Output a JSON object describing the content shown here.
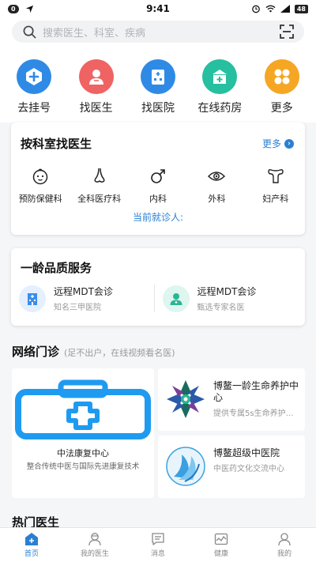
{
  "status_bar": {
    "left_badge": "0",
    "time": "9:41",
    "battery": "48"
  },
  "search": {
    "placeholder": "搜索医生、科室、疾病"
  },
  "quick_actions": [
    {
      "label": "去挂号",
      "icon": "add-circle-icon",
      "color": "#2f8ae6"
    },
    {
      "label": "找医生",
      "icon": "doctor-icon",
      "color": "#ef6363"
    },
    {
      "label": "找医院",
      "icon": "hospital-icon",
      "color": "#2f8ae6"
    },
    {
      "label": "在线药房",
      "icon": "pharmacy-icon",
      "color": "#26bfa0"
    },
    {
      "label": "更多",
      "icon": "more-apps-icon",
      "color": "#f5a623"
    }
  ],
  "dept_section": {
    "title": "按科室找医生",
    "more": "更多",
    "items": [
      {
        "label": "预防保健科",
        "icon": "baby-face-icon"
      },
      {
        "label": "全科医疗科",
        "icon": "nose-icon"
      },
      {
        "label": "内科",
        "icon": "male-symbol-icon"
      },
      {
        "label": "外科",
        "icon": "eye-icon"
      },
      {
        "label": "妇产科",
        "icon": "uterus-icon"
      }
    ],
    "current_patient": "当前就诊人:"
  },
  "quality_section": {
    "title": "一龄品质服务",
    "items": [
      {
        "title": "远程MDT会诊",
        "subtitle": "知名三甲医院",
        "icon": "hospital-building-icon"
      },
      {
        "title": "远程MDT会诊",
        "subtitle": "甄选专家名医",
        "icon": "doctor-avatar-icon"
      }
    ]
  },
  "clinic_section": {
    "title": "网络门诊",
    "subtitle": "(足不出户，在线视频看名医)",
    "left": {
      "title": "中法康复中心",
      "desc": "整合传统中医与国际先进康复技术"
    },
    "right": [
      {
        "title": "博鳌一龄生命养护中心",
        "desc": "提供专属5s生命养护服务"
      },
      {
        "title": "博鳌超级中医院",
        "desc": "中医药文化交流中心"
      }
    ]
  },
  "hot_doctors": {
    "title": "热门医生"
  },
  "tab_bar": [
    {
      "label": "首页",
      "icon": "home-icon",
      "active": true
    },
    {
      "label": "我的医生",
      "icon": "doctor-tab-icon",
      "active": false
    },
    {
      "label": "消息",
      "icon": "message-icon",
      "active": false
    },
    {
      "label": "健康",
      "icon": "health-chart-icon",
      "active": false
    },
    {
      "label": "我的",
      "icon": "profile-icon",
      "active": false
    }
  ],
  "colors": {
    "accent": "#2a7fd4",
    "background": "#f5f6f8"
  }
}
